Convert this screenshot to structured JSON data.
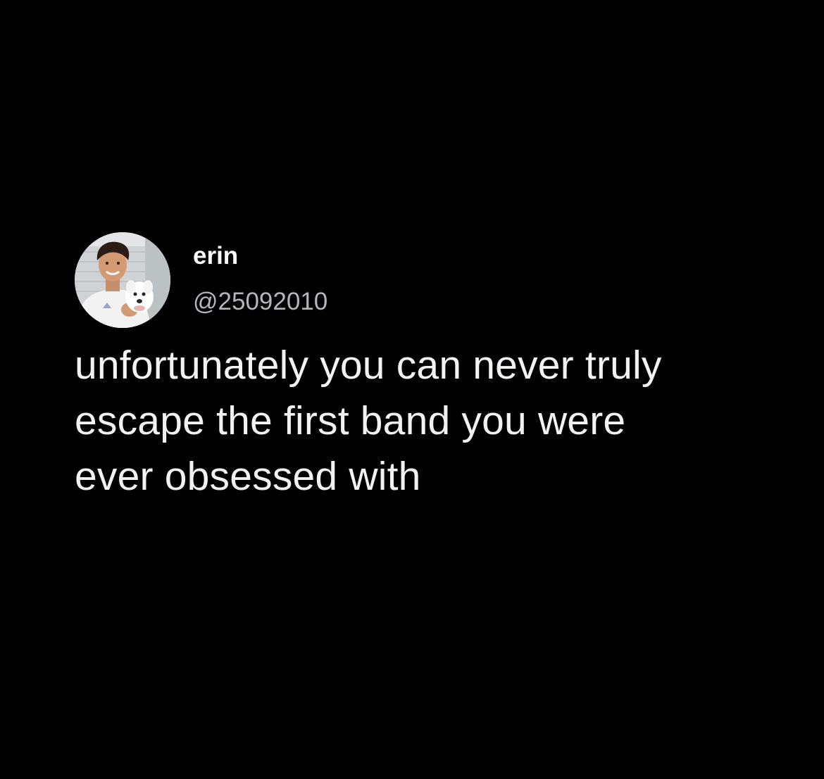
{
  "tweet": {
    "author": {
      "display_name": "erin",
      "handle": "@25092010",
      "avatar_icon": "profile-photo-icon"
    },
    "text": "unfortunately you can never truly\nescape the first band you were\never obsessed with"
  },
  "colors": {
    "background": "#000000",
    "text": "#f0f2f3",
    "handle": "#b3b7bb"
  }
}
